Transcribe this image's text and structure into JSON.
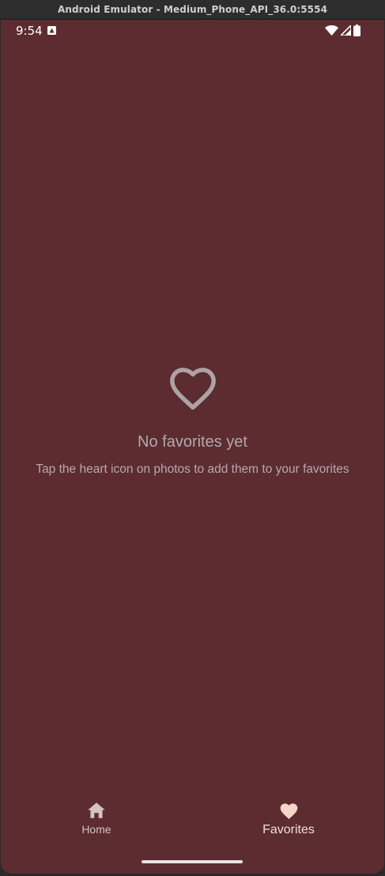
{
  "window": {
    "title": "Android Emulator - Medium_Phone_API_36.0:5554"
  },
  "status_bar": {
    "time": "9:54",
    "icons": [
      "notification-icon",
      "wifi-icon",
      "cell-signal-icon",
      "battery-icon"
    ]
  },
  "empty_state": {
    "icon": "heart-outline-icon",
    "title": "No favorites yet",
    "subtitle": "Tap the heart icon on photos to add them to your favorites"
  },
  "nav": {
    "items": [
      {
        "label": "Home",
        "icon": "home-icon",
        "selected": false
      },
      {
        "label": "Favorites",
        "icon": "heart-icon",
        "selected": true
      }
    ]
  },
  "colors": {
    "background": "#5c2c31",
    "empty_text": "#b3a9a9",
    "nav_selected": "#f0e0dd",
    "nav_unselected": "#d4c3c3",
    "heart_selected": "#f3d6c8"
  }
}
